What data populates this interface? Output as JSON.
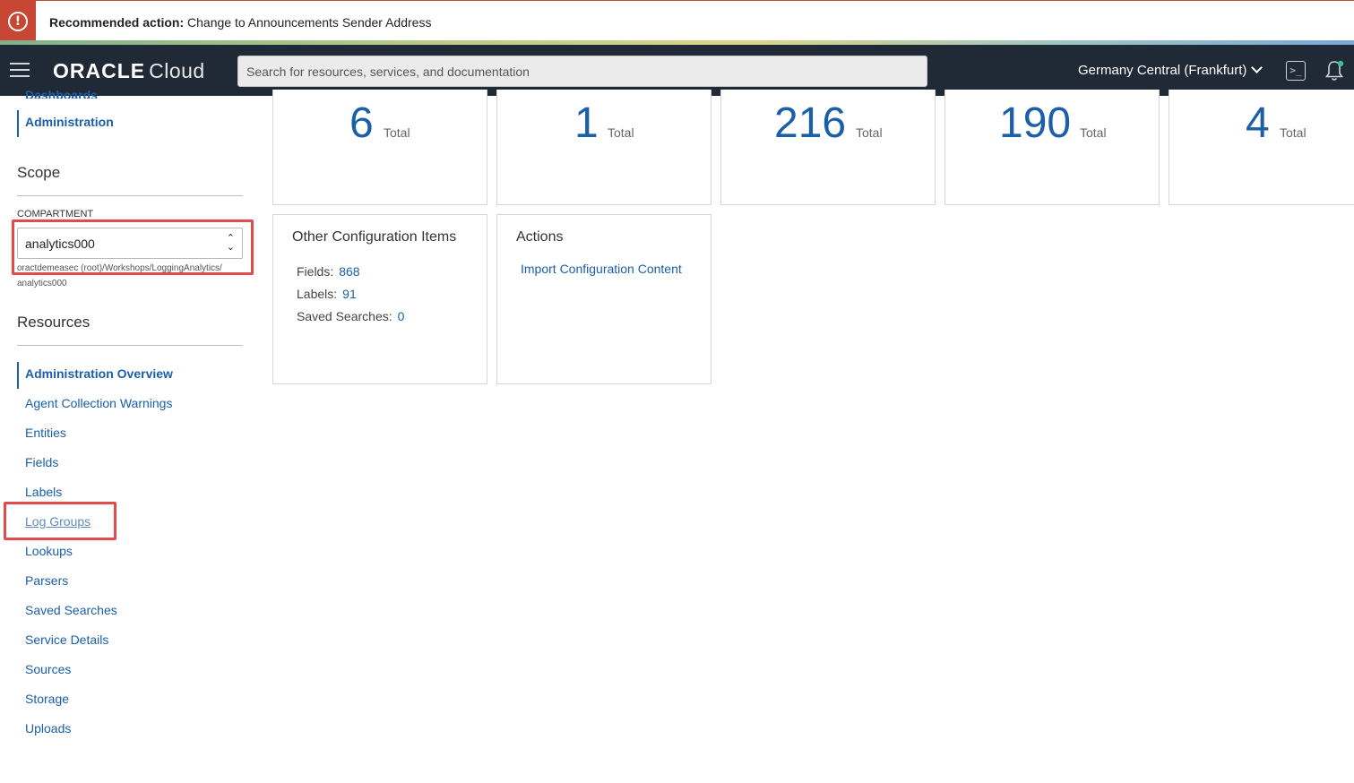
{
  "banner": {
    "alert_glyph": "!",
    "label": "Recommended action:",
    "text": "Change to Announcements Sender Address"
  },
  "header": {
    "logo_brand": "ORACLE",
    "logo_product": "Cloud",
    "search_placeholder": "Search for resources, services, and documentation",
    "region": "Germany Central (Frankfurt)",
    "cloud_shell_glyph": ">_"
  },
  "sidebar": {
    "top_cut_label": "Dashboards",
    "active_section": "Administration",
    "scope_title": "Scope",
    "compartment_label": "COMPARTMENT",
    "compartment_value": "analytics000",
    "compartment_path_line1": "oractdemeasec (root)/Workshops/LoggingAnalytics/",
    "compartment_path_line2": "analytics000",
    "resources_title": "Resources",
    "items": [
      {
        "label": "Administration Overview"
      },
      {
        "label": "Agent Collection Warnings"
      },
      {
        "label": "Entities"
      },
      {
        "label": "Fields"
      },
      {
        "label": "Labels"
      },
      {
        "label": "Log Groups"
      },
      {
        "label": "Lookups"
      },
      {
        "label": "Parsers"
      },
      {
        "label": "Saved Searches"
      },
      {
        "label": "Service Details"
      },
      {
        "label": "Sources"
      },
      {
        "label": "Storage"
      },
      {
        "label": "Uploads"
      }
    ]
  },
  "stats": [
    {
      "value": "6",
      "label": "Total"
    },
    {
      "value": "1",
      "label": "Total"
    },
    {
      "value": "216",
      "label": "Total"
    },
    {
      "value": "190",
      "label": "Total"
    },
    {
      "value": "4",
      "label": "Total"
    }
  ],
  "config_card": {
    "title": "Other Configuration Items",
    "fields_label": "Fields:",
    "fields_value": "868",
    "labels_label": "Labels:",
    "labels_value": "91",
    "saved_searches_label": "Saved Searches:",
    "saved_searches_value": "0"
  },
  "actions_card": {
    "title": "Actions",
    "import_link": "Import Configuration Content"
  },
  "colors": {
    "alert_red": "#c74634",
    "header_bg": "#1f2a36",
    "link_blue": "#1a5fa8",
    "highlight_red": "#e34b4b"
  }
}
